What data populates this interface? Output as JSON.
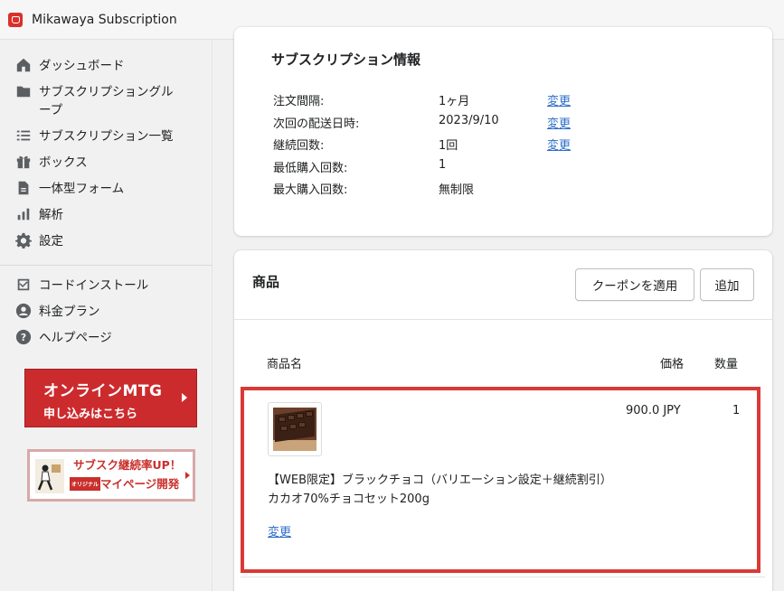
{
  "app": {
    "title": "Mikawaya Subscription"
  },
  "sidebar": {
    "items": [
      {
        "label": "ダッシュボード",
        "icon": "home-icon"
      },
      {
        "label": "サブスクリプショングループ",
        "icon": "folder-icon"
      },
      {
        "label": "サブスクリプション一覧",
        "icon": "list-icon"
      },
      {
        "label": "ボックス",
        "icon": "gift-icon"
      },
      {
        "label": "一体型フォーム",
        "icon": "document-icon"
      },
      {
        "label": "解析",
        "icon": "analytics-icon"
      },
      {
        "label": "設定",
        "icon": "gear-icon"
      }
    ],
    "secondary_items": [
      {
        "label": "コードインストール",
        "icon": "install-icon"
      },
      {
        "label": "料金プラン",
        "icon": "user-circle-icon"
      },
      {
        "label": "ヘルプページ",
        "icon": "help-icon"
      }
    ],
    "banner_mtg": {
      "line1": "オンラインMTG",
      "line2": "申し込みはこちら"
    },
    "banner_mypage": {
      "line1": "サブスク継続率UP！",
      "tag": "オリジナル",
      "line2": "マイページ開発"
    }
  },
  "subscription_info": {
    "title": "サブスクリプション情報",
    "rows": [
      {
        "label": "注文間隔:",
        "value": "1ヶ月",
        "action": "変更"
      },
      {
        "label": "次回の配送日時:",
        "value": "2023/9/10",
        "action": "変更"
      },
      {
        "label": "継続回数:",
        "value": "1回",
        "action": "変更"
      },
      {
        "label": "最低購入回数:",
        "value": "1",
        "action": ""
      },
      {
        "label": "最大購入回数:",
        "value": "無制限",
        "action": ""
      }
    ]
  },
  "products": {
    "title": "商品",
    "coupon_button": "クーポンを適用",
    "add_button": "追加",
    "columns": {
      "name": "商品名",
      "price": "価格",
      "quantity": "数量"
    },
    "items": [
      {
        "name": "【WEB限定】ブラックチョコ（バリエーション設定＋継続割引） カカオ70%チョコセット200g",
        "price": "900.0 JPY",
        "quantity": "1",
        "action": "変更"
      }
    ]
  },
  "colors": {
    "accent_red": "#d93a36",
    "link": "#2c6ecb",
    "banner_red": "#cc2b2e"
  }
}
